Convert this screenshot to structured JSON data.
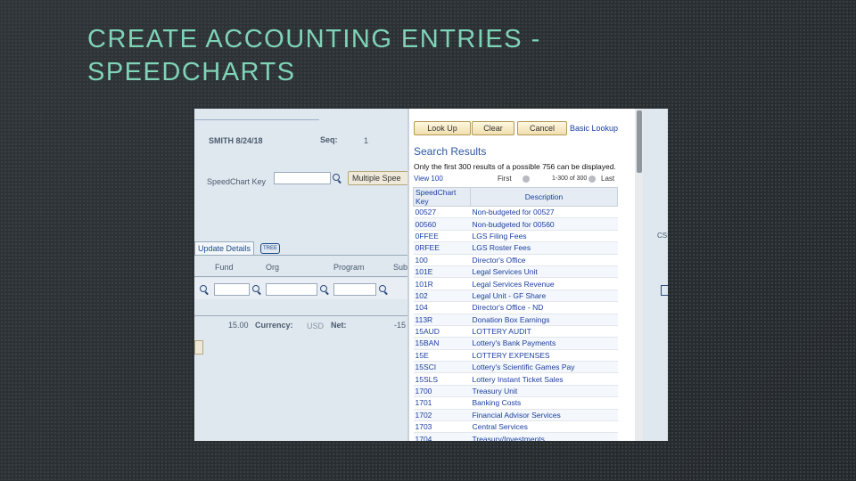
{
  "slide": {
    "title_line1": "CREATE ACCOUNTING ENTRIES -",
    "title_line2": "SPEEDCHARTS"
  },
  "background_page": {
    "header_name": "SMITH 8/24/18",
    "seq_label": "Seq:",
    "seq_value": "1",
    "speedchart_key_label": "SpeedChart Key",
    "multiple_button_label": "Multiple Spee",
    "tab_label": "Update Details",
    "tab_icon_text": "TREE",
    "col_fund": "Fund",
    "col_org": "Org",
    "col_program": "Program",
    "col_sub": "Sub",
    "amount_value": "15.00",
    "currency_label": "Currency:",
    "currency_value": "USD",
    "net_label": "Net:",
    "net_value": "-15"
  },
  "lookup": {
    "buttons": {
      "lookup": "Look Up",
      "clear": "Clear",
      "cancel": "Cancel"
    },
    "basic_lookup_link": "Basic Lookup",
    "search_results_title": "Search Results",
    "results_note": "Only the first 300 results of a possible 756 can be displayed.",
    "nav": {
      "view": "View 100",
      "first": "First",
      "range": "1-300 of 300",
      "last": "Last"
    },
    "columns": {
      "key": "SpeedChart Key",
      "description": "Description"
    },
    "rows": [
      {
        "key": "00527",
        "description": "Non-budgeted for 00527"
      },
      {
        "key": "00560",
        "description": "Non-budgeted for 00560"
      },
      {
        "key": "0FFEE",
        "description": "LGS Filing Fees"
      },
      {
        "key": "0RFEE",
        "description": "LGS Roster Fees"
      },
      {
        "key": "100",
        "description": "Director's Office"
      },
      {
        "key": "101E",
        "description": "Legal Services Unit"
      },
      {
        "key": "101R",
        "description": "Legal Services Revenue"
      },
      {
        "key": "102",
        "description": "Legal Unit - GF Share"
      },
      {
        "key": "104",
        "description": "Director's Office - ND"
      },
      {
        "key": "113R",
        "description": "Donation Box Earnings"
      },
      {
        "key": "15AUD",
        "description": "LOTTERY AUDIT"
      },
      {
        "key": "15BAN",
        "description": "Lottery's Bank Payments"
      },
      {
        "key": "15E",
        "description": "LOTTERY EXPENSES"
      },
      {
        "key": "15SCI",
        "description": "Lottery's Scientific Games Pay"
      },
      {
        "key": "15SLS",
        "description": "Lottery Instant Ticket Sales"
      },
      {
        "key": "1700",
        "description": "Treasury Unit"
      },
      {
        "key": "1701",
        "description": "Banking Costs"
      },
      {
        "key": "1702",
        "description": "Financial Advisor Services"
      },
      {
        "key": "1703",
        "description": "Central Services"
      },
      {
        "key": "1704",
        "description": "Treasury/Investments"
      }
    ]
  },
  "right_sliver": {
    "text": "CSI"
  }
}
